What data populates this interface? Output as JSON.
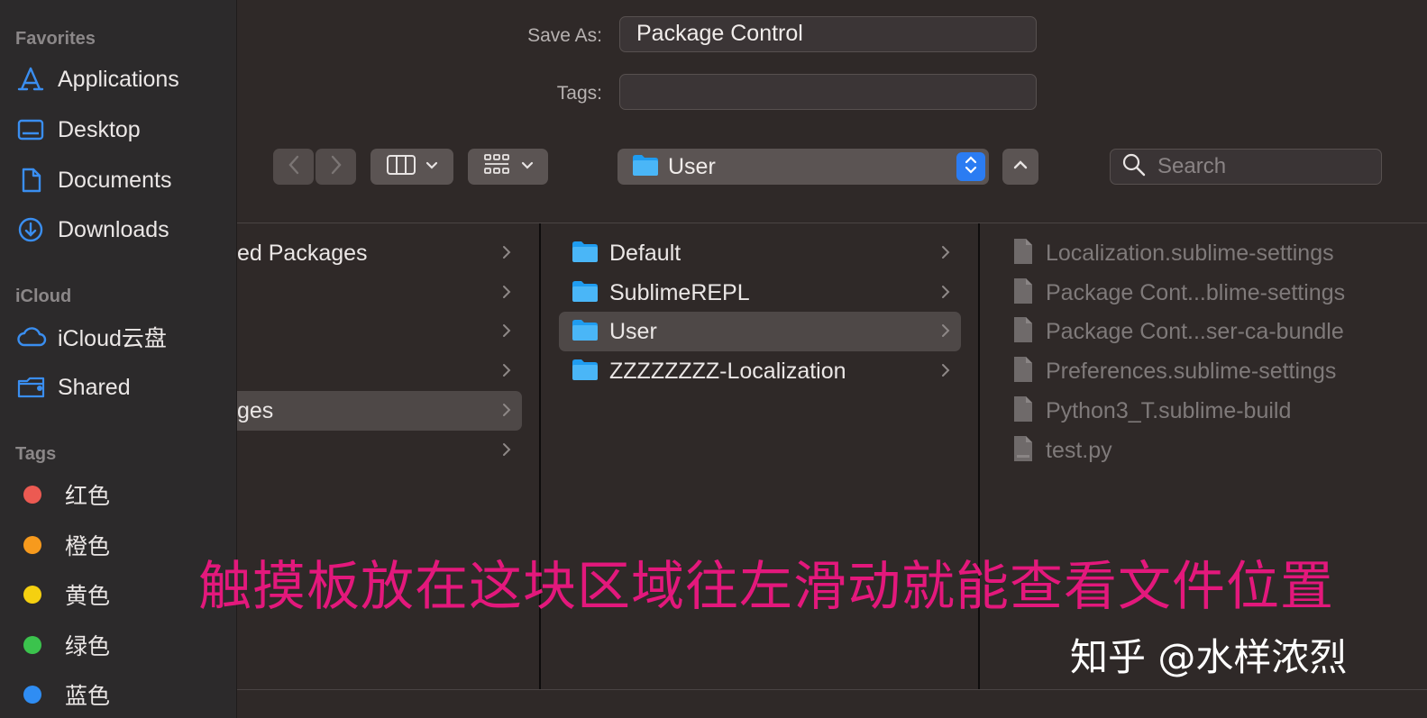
{
  "sidebar": {
    "favorites_title": "Favorites",
    "favorites": [
      {
        "label": "Applications",
        "icon": "applications-icon"
      },
      {
        "label": "Desktop",
        "icon": "desktop-icon"
      },
      {
        "label": "Documents",
        "icon": "document-icon"
      },
      {
        "label": "Downloads",
        "icon": "downloads-icon"
      }
    ],
    "icloud_title": "iCloud",
    "icloud": [
      {
        "label": "iCloud云盘",
        "icon": "cloud-icon"
      },
      {
        "label": "Shared",
        "icon": "shared-folder-icon"
      }
    ],
    "tags_title": "Tags",
    "tags": [
      {
        "label": "红色",
        "color": "#ec5a52"
      },
      {
        "label": "橙色",
        "color": "#f79a1d"
      },
      {
        "label": "黄色",
        "color": "#f5d010"
      },
      {
        "label": "绿色",
        "color": "#3bc34d"
      },
      {
        "label": "蓝色",
        "color": "#2f8df3"
      }
    ],
    "accent_color": "#3a8ef0"
  },
  "save_dialog": {
    "save_as_label": "Save As:",
    "save_as_value": "Package Control",
    "tags_label": "Tags:",
    "tags_value": ""
  },
  "toolbar": {
    "location": "User",
    "search_placeholder": "Search"
  },
  "browser": {
    "column1": [
      {
        "label": "ed Packages",
        "selected": false
      },
      {
        "label": "",
        "selected": false
      },
      {
        "label": "",
        "selected": false
      },
      {
        "label": "",
        "selected": false
      },
      {
        "label": "ges",
        "selected": true
      },
      {
        "label": "",
        "selected": false
      }
    ],
    "column2": [
      {
        "label": "Default",
        "selected": false
      },
      {
        "label": "SublimeREPL",
        "selected": false
      },
      {
        "label": "User",
        "selected": true
      },
      {
        "label": "ZZZZZZZZ-Localization",
        "selected": false
      }
    ],
    "column3": [
      "Localization.sublime-settings",
      "Package Cont...blime-settings",
      "Package Cont...ser-ca-bundle",
      "Preferences.sublime-settings",
      "Python3_T.sublime-build",
      "test.py"
    ]
  },
  "overlay": {
    "instruction": "触摸板放在这块区域往左滑动就能查看文件位置",
    "instruction_color": "#e3187c",
    "watermark": "知乎 @水样浓烈"
  }
}
